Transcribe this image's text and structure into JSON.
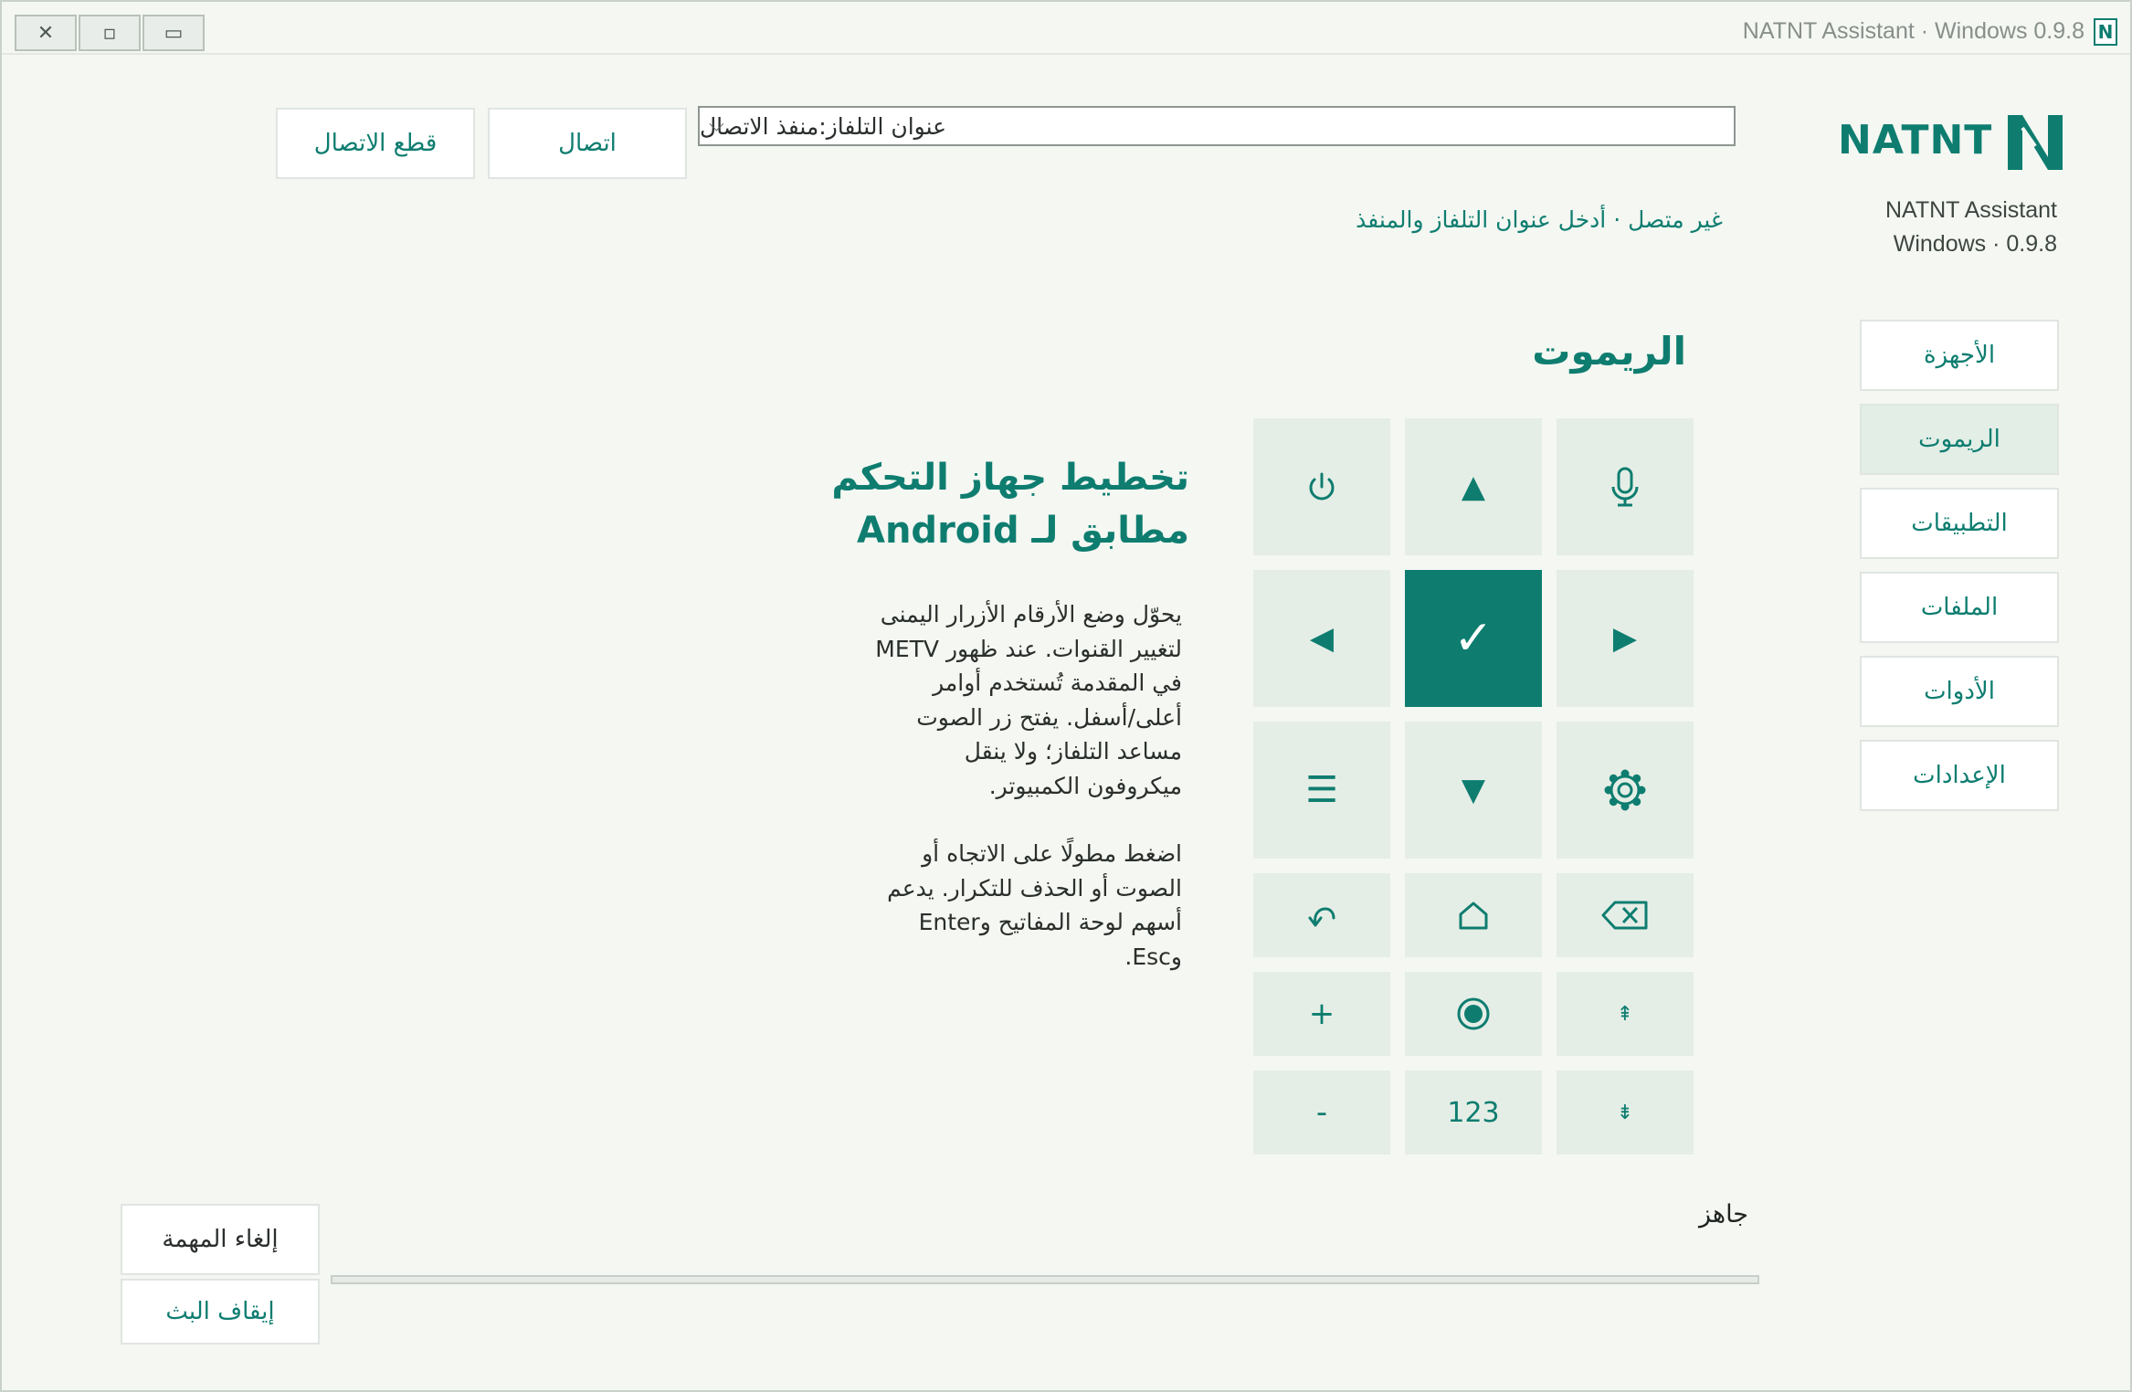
{
  "window": {
    "title": "NATNT Assistant · Windows 0.9.8",
    "logo_letter": "N",
    "controls": {
      "close": "✕",
      "restore": "▫",
      "minimize": "▭"
    }
  },
  "brand": {
    "name": "NATNT",
    "app_name": "NATNT Assistant",
    "platform_version": "Windows · 0.9.8",
    "accent_color": "#0e7d70"
  },
  "connection": {
    "address_placeholder": "عنوان التلفاز:منفذ الاتصال",
    "connect_label": "اتصال",
    "disconnect_label": "قطع الاتصال",
    "status_text": "غير متصل · أدخل عنوان التلفاز والمنفذ"
  },
  "sidebar": {
    "items": [
      {
        "label": "الأجهزة",
        "active": false
      },
      {
        "label": "الريموت",
        "active": true
      },
      {
        "label": "التطبيقات",
        "active": false
      },
      {
        "label": "الملفات",
        "active": false
      },
      {
        "label": "الأدوات",
        "active": false
      },
      {
        "label": "الإعدادات",
        "active": false
      }
    ]
  },
  "remote": {
    "section_title": "الريموت",
    "keys": {
      "power": "power-icon",
      "up": "▲",
      "mic": "microphone-icon",
      "left": "◀",
      "ok": "✓",
      "right": "▶",
      "menu": "☰",
      "down": "▼",
      "settings": "gear-icon",
      "back": "back-icon",
      "home": "home-icon",
      "delete": "backspace-icon",
      "vol_up": "+",
      "record": "record-icon",
      "ch_up": "⇞",
      "vol_down": "-",
      "numbers": "123",
      "ch_down": "⇟"
    }
  },
  "guide": {
    "title_line1": "تخطيط جهاز التحكم",
    "title_line2": "مطابق لـ Android",
    "paragraph1_lines": [
      "يحوّل وضع الأرقام الأزرار اليمنى",
      "لتغيير القنوات. عند ظهور METV",
      "في المقدمة تُستخدم أوامر",
      "أعلى/أسفل. يفتح زر الصوت",
      "مساعد التلفاز؛ ولا ينقل",
      "ميكروفون الكمبيوتر."
    ],
    "paragraph2_lines": [
      "اضغط مطولًا على الاتجاه أو",
      "الصوت أو الحذف للتكرار. يدعم",
      "أسهم لوحة المفاتيح وEnter",
      "وEsc."
    ]
  },
  "footer": {
    "status": "جاهز",
    "progress": 0,
    "cancel_task_label": "إلغاء المهمة",
    "stop_stream_label": "إيقاف البث"
  }
}
